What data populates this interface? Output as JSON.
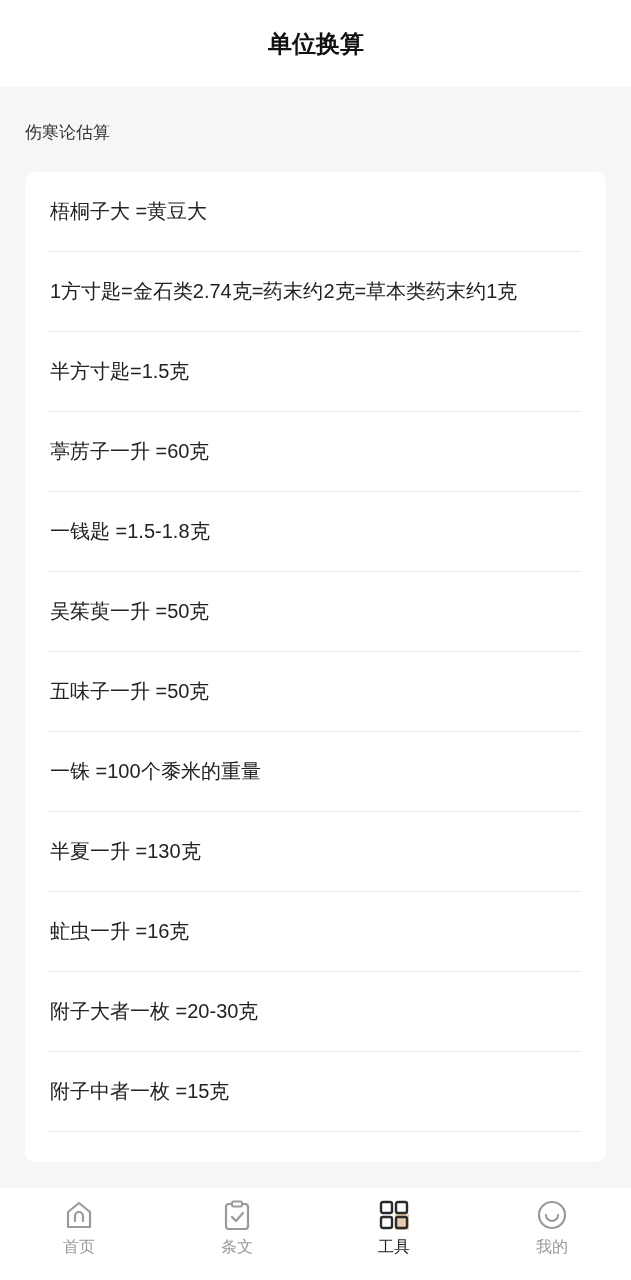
{
  "header": {
    "title": "单位换算"
  },
  "section": {
    "title": "伤寒论估算"
  },
  "conversions": [
    {
      "text": "梧桐子大 =黄豆大"
    },
    {
      "text": "1方寸匙=金石类2.74克=药末约2克=草本类药末约1克"
    },
    {
      "text": "半方寸匙=1.5克"
    },
    {
      "text": "葶苈子一升 =60克"
    },
    {
      "text": "一钱匙 =1.5-1.8克"
    },
    {
      "text": "吴茱萸一升 =50克"
    },
    {
      "text": "五味子一升 =50克"
    },
    {
      "text": "一铢 =100个黍米的重量"
    },
    {
      "text": "半夏一升 =130克"
    },
    {
      "text": "虻虫一升 =16克"
    },
    {
      "text": "附子大者一枚 =20-30克"
    },
    {
      "text": "附子中者一枚 =15克"
    }
  ],
  "tab_bar": [
    {
      "label": "首页",
      "kind": "home",
      "selected": false
    },
    {
      "label": "条文",
      "kind": "clipboard",
      "selected": false
    },
    {
      "label": "工具",
      "kind": "grid",
      "selected": true
    },
    {
      "label": "我的",
      "kind": "smile",
      "selected": false
    }
  ]
}
